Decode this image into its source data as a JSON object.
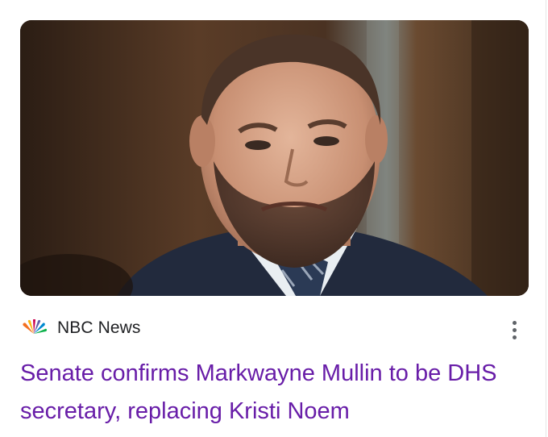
{
  "card": {
    "image_alt": "Man with beard in dark suit and tie",
    "source": {
      "name": "NBC News",
      "logo_icon": "nbc-peacock-icon"
    },
    "more_icon": "more-vert-icon",
    "headline": "Senate confirms Markwayne Mullin to be DHS secretary, replacing Kristi Noem"
  },
  "colors": {
    "headline_visited": "#681da8",
    "source_text": "#202124",
    "icon_gray": "#5f6368"
  }
}
